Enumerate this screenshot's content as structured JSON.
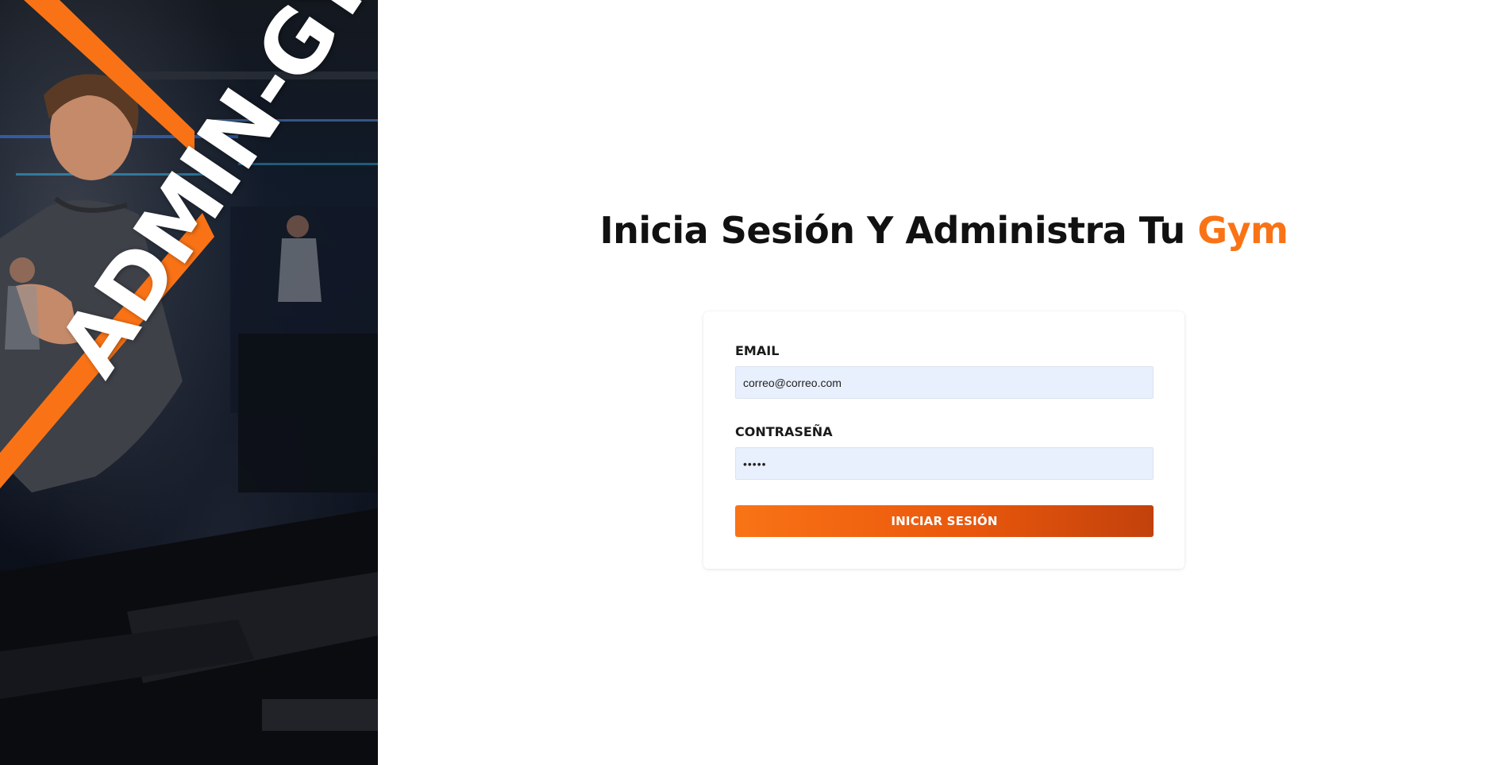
{
  "hero": {
    "logo_text": "ADMIN-GYM",
    "image_icon": "gym-athlete-photo",
    "accent_color": "#f97316"
  },
  "headline": {
    "prefix": "Inicia Sesión Y Administra Tu ",
    "accent": "Gym",
    "accent_color": "#f97316"
  },
  "login_form": {
    "email_label": "EMAIL",
    "email_value": "correo@correo.com",
    "password_label": "CONTRASEÑA",
    "password_value": "•••••",
    "submit_label": "INICIAR SESIÓN",
    "input_background": "#e8f0fe"
  }
}
